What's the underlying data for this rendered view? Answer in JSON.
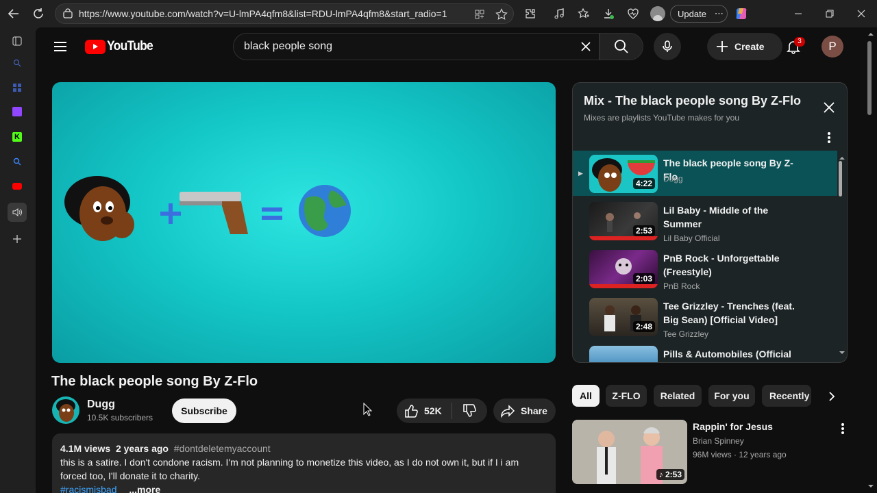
{
  "browser": {
    "url": "https://www.youtube.com/watch?v=U-lmPA4qfm8&list=RDU-lmPA4qfm8&start_radio=1",
    "update_label": "Update",
    "update_more": "⋯"
  },
  "yt": {
    "logo_text": "YouTube",
    "search_value": "black people song",
    "create_label": "Create",
    "notification_count": "3",
    "account_initial": "P"
  },
  "video": {
    "title": "The black people song By Z-Flo",
    "channel": "Dugg",
    "subscribers": "10.5K subscribers",
    "subscribe_label": "Subscribe",
    "likes": "52K",
    "share_label": "Share",
    "views": "4.1M views",
    "age": "2 years ago",
    "hashtag": "#dontdeletemyaccount",
    "description": "this is a satire. I don't condone racism. I'm not planning to monetize this video, as I do not own it, but if I i am forced too, I'll donate it to charity.",
    "hashtag2": "#racismisbad",
    "more_label": "...more"
  },
  "mix": {
    "title": "Mix - The black people song By Z-Flo",
    "subtitle": "Mixes are playlists YouTube makes for you",
    "items": [
      {
        "title": "The black people song By Z-Flo",
        "channel": "Dugg",
        "duration": "4:22",
        "active": true
      },
      {
        "title": "Lil Baby - Middle of the Summer",
        "channel": "Lil Baby Official",
        "duration": "2:53"
      },
      {
        "title": "PnB Rock - Unforgettable (Freestyle)",
        "channel": "PnB Rock",
        "duration": "2:03"
      },
      {
        "title": "Tee Grizzley - Trenches (feat. Big Sean) [Official Video]",
        "channel": "Tee Grizzley",
        "duration": "2:48"
      },
      {
        "title": "Pills & Automobiles (Official Video)",
        "channel": "",
        "duration": ""
      }
    ]
  },
  "chips": [
    "All",
    "Z-FLO",
    "Related",
    "For you",
    "Recently uploaded"
  ],
  "recommendation": {
    "title": "Rappin' for Jesus",
    "channel": "Brian Spinney",
    "meta": "96M views · 12 years ago",
    "duration": "♪ 2:53"
  },
  "colors": {
    "brand_red": "#ff0000",
    "active_row": "#0a5256",
    "player_bg": "#14c8c8"
  }
}
